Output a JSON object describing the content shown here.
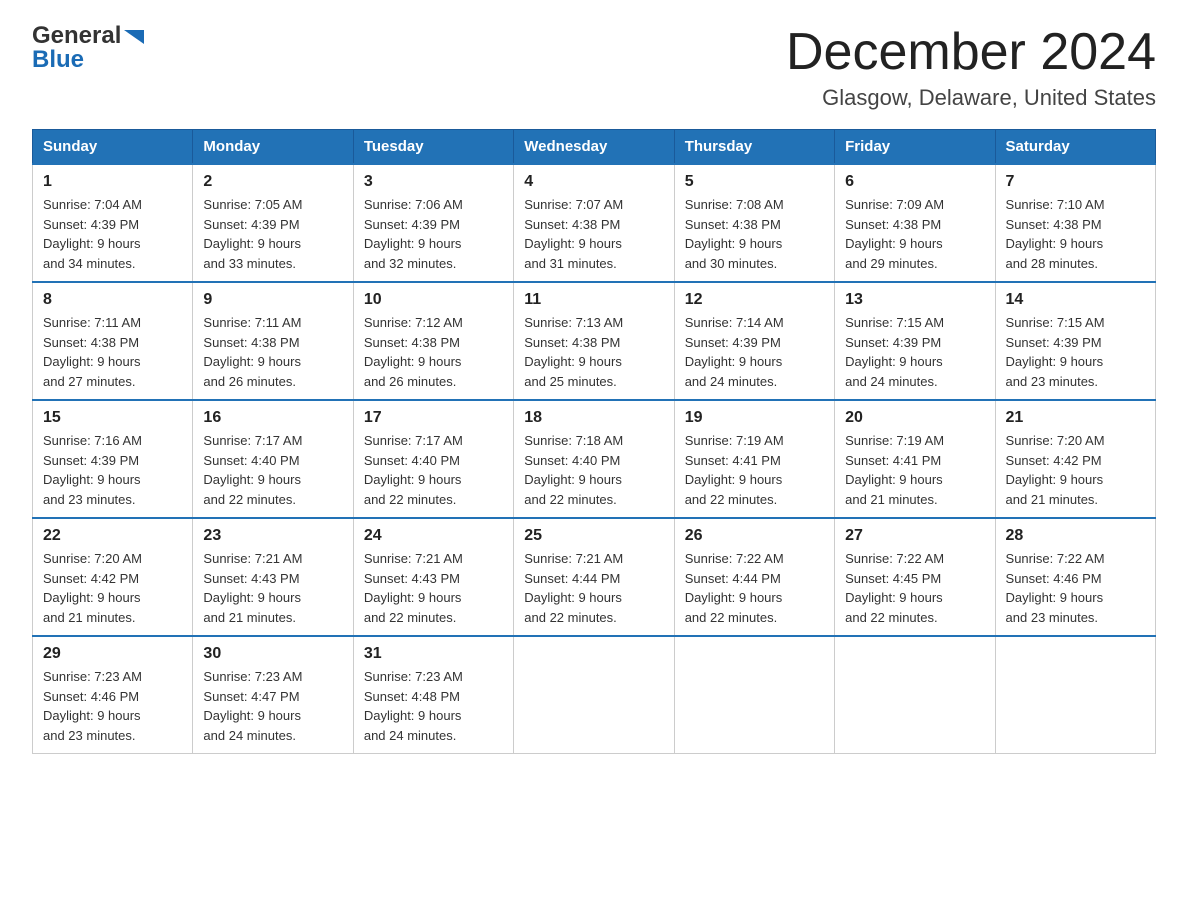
{
  "header": {
    "logo_general": "General",
    "logo_blue": "Blue",
    "month_title": "December 2024",
    "location": "Glasgow, Delaware, United States"
  },
  "days_of_week": [
    "Sunday",
    "Monday",
    "Tuesday",
    "Wednesday",
    "Thursday",
    "Friday",
    "Saturday"
  ],
  "weeks": [
    [
      {
        "day": "1",
        "sunrise": "7:04 AM",
        "sunset": "4:39 PM",
        "daylight": "9 hours and 34 minutes."
      },
      {
        "day": "2",
        "sunrise": "7:05 AM",
        "sunset": "4:39 PM",
        "daylight": "9 hours and 33 minutes."
      },
      {
        "day": "3",
        "sunrise": "7:06 AM",
        "sunset": "4:39 PM",
        "daylight": "9 hours and 32 minutes."
      },
      {
        "day": "4",
        "sunrise": "7:07 AM",
        "sunset": "4:38 PM",
        "daylight": "9 hours and 31 minutes."
      },
      {
        "day": "5",
        "sunrise": "7:08 AM",
        "sunset": "4:38 PM",
        "daylight": "9 hours and 30 minutes."
      },
      {
        "day": "6",
        "sunrise": "7:09 AM",
        "sunset": "4:38 PM",
        "daylight": "9 hours and 29 minutes."
      },
      {
        "day": "7",
        "sunrise": "7:10 AM",
        "sunset": "4:38 PM",
        "daylight": "9 hours and 28 minutes."
      }
    ],
    [
      {
        "day": "8",
        "sunrise": "7:11 AM",
        "sunset": "4:38 PM",
        "daylight": "9 hours and 27 minutes."
      },
      {
        "day": "9",
        "sunrise": "7:11 AM",
        "sunset": "4:38 PM",
        "daylight": "9 hours and 26 minutes."
      },
      {
        "day": "10",
        "sunrise": "7:12 AM",
        "sunset": "4:38 PM",
        "daylight": "9 hours and 26 minutes."
      },
      {
        "day": "11",
        "sunrise": "7:13 AM",
        "sunset": "4:38 PM",
        "daylight": "9 hours and 25 minutes."
      },
      {
        "day": "12",
        "sunrise": "7:14 AM",
        "sunset": "4:39 PM",
        "daylight": "9 hours and 24 minutes."
      },
      {
        "day": "13",
        "sunrise": "7:15 AM",
        "sunset": "4:39 PM",
        "daylight": "9 hours and 24 minutes."
      },
      {
        "day": "14",
        "sunrise": "7:15 AM",
        "sunset": "4:39 PM",
        "daylight": "9 hours and 23 minutes."
      }
    ],
    [
      {
        "day": "15",
        "sunrise": "7:16 AM",
        "sunset": "4:39 PM",
        "daylight": "9 hours and 23 minutes."
      },
      {
        "day": "16",
        "sunrise": "7:17 AM",
        "sunset": "4:40 PM",
        "daylight": "9 hours and 22 minutes."
      },
      {
        "day": "17",
        "sunrise": "7:17 AM",
        "sunset": "4:40 PM",
        "daylight": "9 hours and 22 minutes."
      },
      {
        "day": "18",
        "sunrise": "7:18 AM",
        "sunset": "4:40 PM",
        "daylight": "9 hours and 22 minutes."
      },
      {
        "day": "19",
        "sunrise": "7:19 AM",
        "sunset": "4:41 PM",
        "daylight": "9 hours and 22 minutes."
      },
      {
        "day": "20",
        "sunrise": "7:19 AM",
        "sunset": "4:41 PM",
        "daylight": "9 hours and 21 minutes."
      },
      {
        "day": "21",
        "sunrise": "7:20 AM",
        "sunset": "4:42 PM",
        "daylight": "9 hours and 21 minutes."
      }
    ],
    [
      {
        "day": "22",
        "sunrise": "7:20 AM",
        "sunset": "4:42 PM",
        "daylight": "9 hours and 21 minutes."
      },
      {
        "day": "23",
        "sunrise": "7:21 AM",
        "sunset": "4:43 PM",
        "daylight": "9 hours and 21 minutes."
      },
      {
        "day": "24",
        "sunrise": "7:21 AM",
        "sunset": "4:43 PM",
        "daylight": "9 hours and 22 minutes."
      },
      {
        "day": "25",
        "sunrise": "7:21 AM",
        "sunset": "4:44 PM",
        "daylight": "9 hours and 22 minutes."
      },
      {
        "day": "26",
        "sunrise": "7:22 AM",
        "sunset": "4:44 PM",
        "daylight": "9 hours and 22 minutes."
      },
      {
        "day": "27",
        "sunrise": "7:22 AM",
        "sunset": "4:45 PM",
        "daylight": "9 hours and 22 minutes."
      },
      {
        "day": "28",
        "sunrise": "7:22 AM",
        "sunset": "4:46 PM",
        "daylight": "9 hours and 23 minutes."
      }
    ],
    [
      {
        "day": "29",
        "sunrise": "7:23 AM",
        "sunset": "4:46 PM",
        "daylight": "9 hours and 23 minutes."
      },
      {
        "day": "30",
        "sunrise": "7:23 AM",
        "sunset": "4:47 PM",
        "daylight": "9 hours and 24 minutes."
      },
      {
        "day": "31",
        "sunrise": "7:23 AM",
        "sunset": "4:48 PM",
        "daylight": "9 hours and 24 minutes."
      },
      null,
      null,
      null,
      null
    ]
  ],
  "labels": {
    "sunrise_prefix": "Sunrise: ",
    "sunset_prefix": "Sunset: ",
    "daylight_prefix": "Daylight: "
  }
}
